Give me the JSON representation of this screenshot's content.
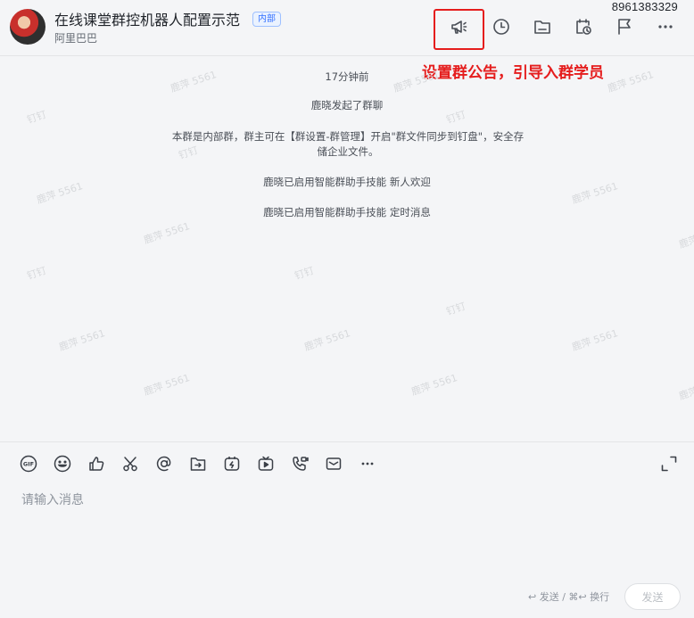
{
  "header": {
    "group_title": "在线课堂群控机器人配置示范",
    "badge": "内部",
    "org_name": "阿里巴巴",
    "phone": "8961383329",
    "icons": [
      "announcement-icon",
      "history-clock-icon",
      "folder-icon",
      "schedule-icon",
      "flag-icon",
      "more-icon"
    ]
  },
  "annotation": "设置群公告，引导入群学员",
  "messages": {
    "time": "17分钟前",
    "started": "鹿晓发起了群聊",
    "notice": "本群是内部群，群主可在【群设置-群管理】开启\"群文件同步到钉盘\"，安全存储企业文件。",
    "ai_welcome": "鹿晓已启用智能群助手技能 新人欢迎",
    "ai_timed": "鹿晓已启用智能群助手技能 定时消息"
  },
  "watermark": {
    "name": "鹿萍 5561",
    "brand": "钉钉"
  },
  "composer": {
    "tools": [
      "gif-icon",
      "emoji-icon",
      "thumbs-up-icon",
      "scissors-icon",
      "mention-icon",
      "share-icon",
      "flash-icon",
      "live-icon",
      "call-icon",
      "mail-icon",
      "more-dots-icon"
    ],
    "placeholder": "请输入消息",
    "send_hint": "↩ 发送 / ⌘↩ 换行",
    "send_label": "发送"
  }
}
